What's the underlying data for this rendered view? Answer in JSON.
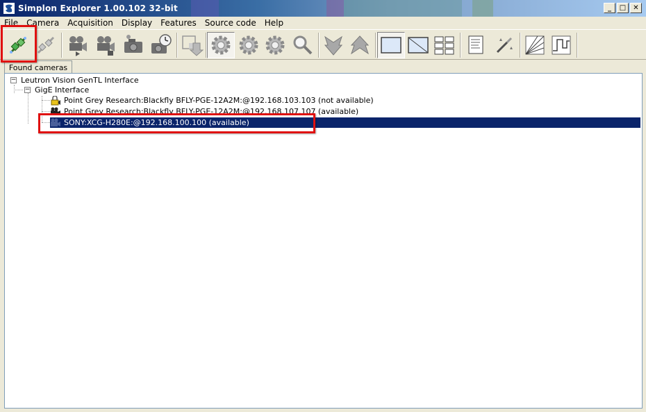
{
  "window": {
    "title": "Simplon Explorer 1.00.102 32-bit"
  },
  "titlebar_buttons": {
    "minimize": "_",
    "maximize": "□",
    "close": "✕"
  },
  "menu": [
    "File",
    "Camera",
    "Acquisition",
    "Display",
    "Features",
    "Source code",
    "Help"
  ],
  "toolbar": {
    "icons": [
      "connect-icon",
      "disconnect-icon",
      "play-video-icon",
      "record-video-icon",
      "camera-snapshot-icon",
      "timed-capture-icon",
      "export-icon",
      "gear-1-icon",
      "gear-2-icon",
      "gear-3-icon",
      "magnifier-icon",
      "arrow-down-icon",
      "arrow-up-icon",
      "frame-single-icon",
      "frame-diagonal-icon",
      "grid-icon",
      "document-icon",
      "magic-wand-icon",
      "chart-lines-icon",
      "waveform-icon"
    ]
  },
  "tab": {
    "label": "Found cameras"
  },
  "tree": {
    "root": "Leutron Vision GenTL Interface",
    "interface": "GigE Interface",
    "cameras": [
      {
        "label": "Point Grey Research:Blackfly BFLY-PGE-12A2M:@192.168.103.103 (not available)"
      },
      {
        "label": "Point Grey Research:Blackfly BFLY-PGE-12A2M:@192.168.107.107 (available)"
      },
      {
        "label": "SONY:XCG-H280E:@192.168.100.100 (available)"
      }
    ],
    "expander_minus": "−"
  },
  "colors": {
    "selection": "#0a246a",
    "highlight": "#e01010",
    "title_start": "#0a246a"
  }
}
